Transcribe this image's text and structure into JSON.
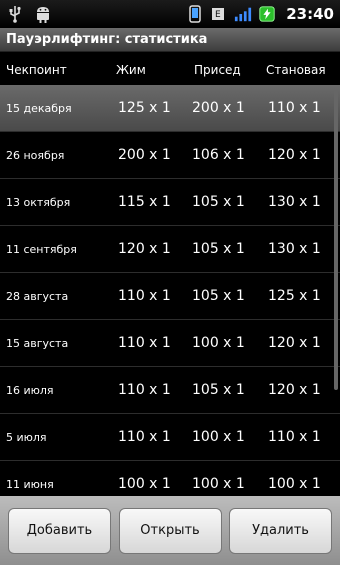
{
  "status_bar": {
    "time": "23:40",
    "battery_icon": "battery-icon",
    "signal_icon": "signal-icon",
    "usb_icon": "usb-icon",
    "android_icon": "android-icon"
  },
  "title": "Пауэрлифтинг: статистика",
  "table": {
    "headers": [
      "Чекпоинт",
      "Жим",
      "Присед",
      "Становая"
    ],
    "rows": [
      {
        "date": "15 декабря",
        "bench": "125 x 1",
        "squat": "200 x 1",
        "deadlift": "110 x 1"
      },
      {
        "date": "26 ноября",
        "bench": "200 x 1",
        "squat": "106 x 1",
        "deadlift": "120 x 1"
      },
      {
        "date": "13 октября",
        "bench": "115 x 1",
        "squat": "105 x 1",
        "deadlift": "130 x 1"
      },
      {
        "date": "11 сентября",
        "bench": "120 x 1",
        "squat": "105 x 1",
        "deadlift": "130 x 1"
      },
      {
        "date": "28 августа",
        "bench": "110 x 1",
        "squat": "105 x 1",
        "deadlift": "125 x 1"
      },
      {
        "date": "15 августа",
        "bench": "110 x 1",
        "squat": "100 x 1",
        "deadlift": "120 x 1"
      },
      {
        "date": "16 июля",
        "bench": "110 x 1",
        "squat": "105 x 1",
        "deadlift": "120 x 1"
      },
      {
        "date": "5 июля",
        "bench": "110 x 1",
        "squat": "100 x 1",
        "deadlift": "110 x 1"
      },
      {
        "date": "11 июня",
        "bench": "100 x 1",
        "squat": "100 x 1",
        "deadlift": "100 x 1"
      }
    ]
  },
  "buttons": {
    "add": "Добавить",
    "open": "Открыть",
    "delete": "Удалить"
  }
}
